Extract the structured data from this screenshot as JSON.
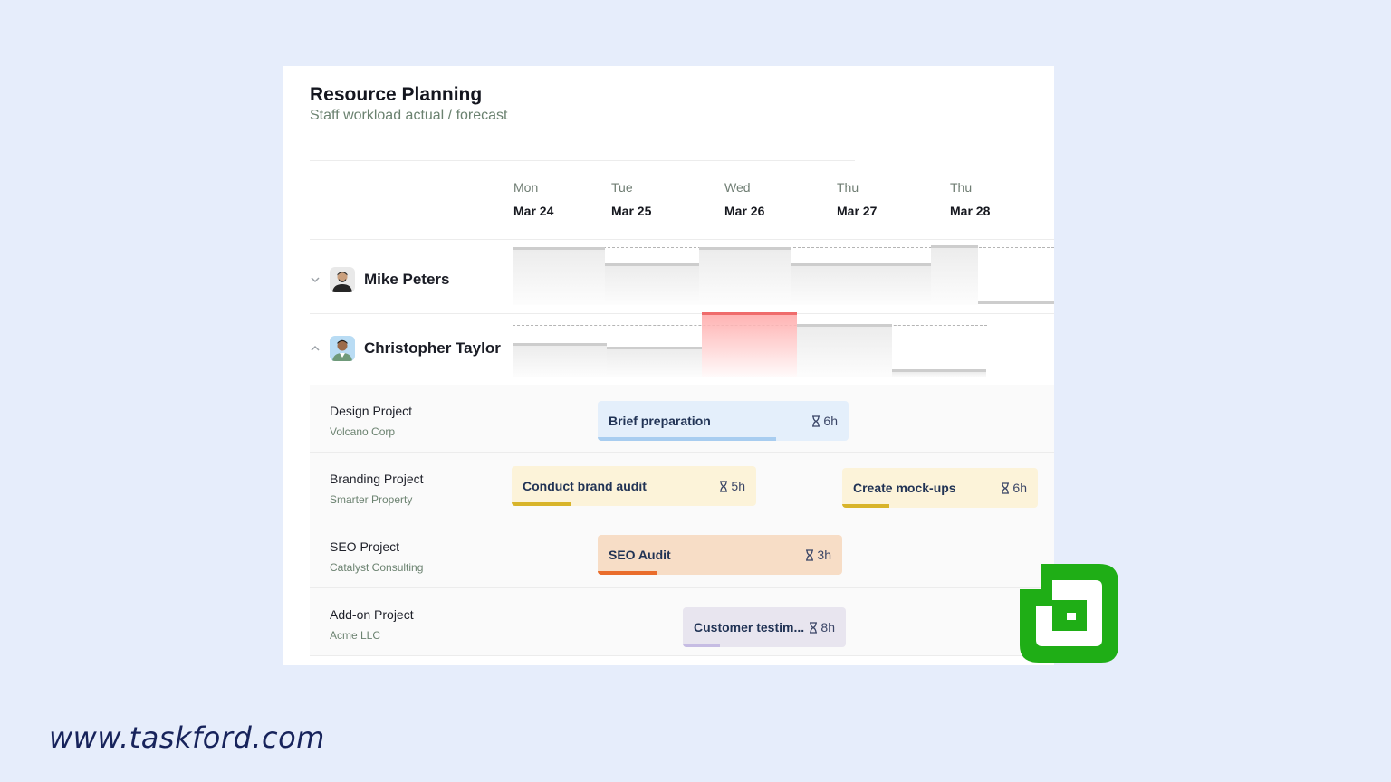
{
  "header": {
    "title": "Resource Planning",
    "subtitle": "Staff workload actual / forecast"
  },
  "days": [
    {
      "dow": "Mon",
      "date": "Mar 24"
    },
    {
      "dow": "Tue",
      "date": "Mar 25"
    },
    {
      "dow": "Wed",
      "date": "Mar 26"
    },
    {
      "dow": "Thu",
      "date": "Mar 27"
    },
    {
      "dow": "Thu",
      "date": "Mar 28"
    }
  ],
  "people": [
    {
      "name": "Mike Peters",
      "expanded": false,
      "avatar_icon": "person-avatar-icon"
    },
    {
      "name": "Christopher Taylor",
      "expanded": true,
      "avatar_icon": "person-avatar-icon",
      "overbooked_day": "Mar 26"
    }
  ],
  "projects": [
    {
      "name": "Design Project",
      "client": "Volcano Corp",
      "tasks": [
        {
          "label": "Brief preparation",
          "duration": "6h",
          "progress": 0.71,
          "color": "#e4effb",
          "bar": "#a8cdf0"
        }
      ]
    },
    {
      "name": "Branding Project",
      "client": "Smarter Property",
      "tasks": [
        {
          "label": "Conduct brand audit",
          "duration": "5h",
          "progress": 0.24,
          "color": "#fcf3d9",
          "bar": "#d8b42a"
        },
        {
          "label": "Create mock-ups",
          "duration": "6h",
          "progress": 0.24,
          "color": "#fcf3d9",
          "bar": "#d8b42a"
        }
      ]
    },
    {
      "name": "SEO Project",
      "client": "Catalyst Consulting",
      "tasks": [
        {
          "label": "SEO Audit",
          "duration": "3h",
          "progress": 0.24,
          "color": "#f7ddc6",
          "bar": "#ea6d2c"
        }
      ]
    },
    {
      "name": "Add-on Project",
      "client": "Acme LLC",
      "tasks": [
        {
          "label": "Customer testim...",
          "duration": "8h",
          "progress": 0.23,
          "color": "#e8e5ef",
          "bar": "#c6bce3"
        }
      ]
    }
  ],
  "colors": {
    "background": "#e6edfb",
    "overbooked": "#ef6b6b",
    "logo_green": "#1fae16",
    "url_color": "#17235b"
  },
  "footer": {
    "url": "www.taskford.com"
  }
}
